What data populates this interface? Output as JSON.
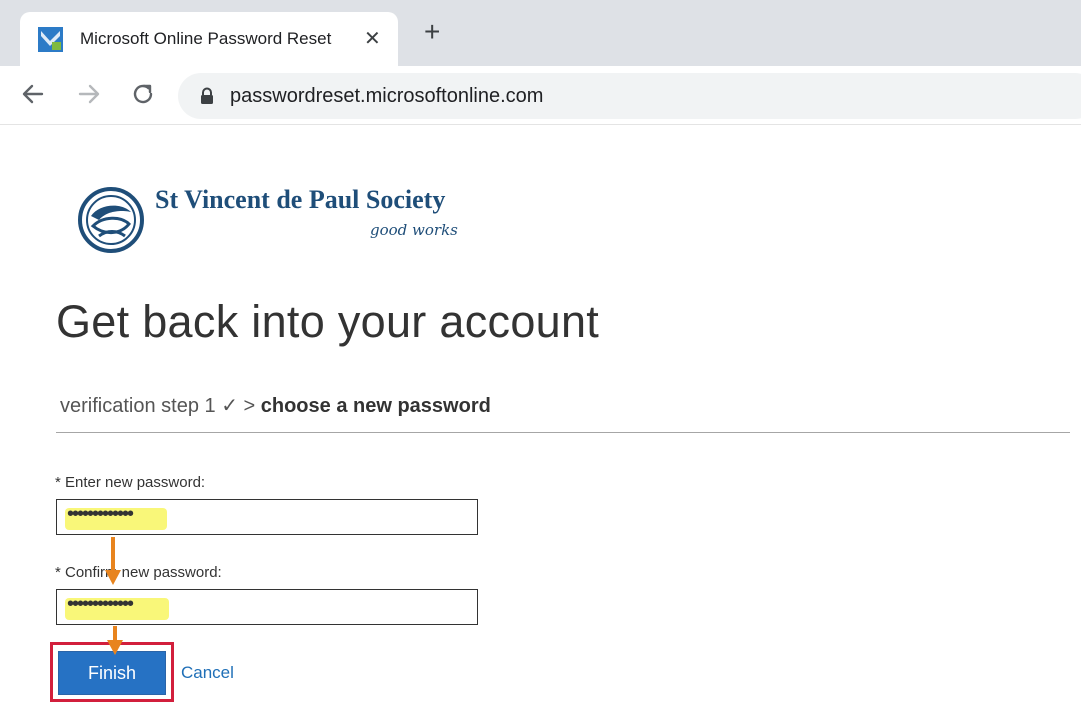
{
  "browser": {
    "tab": {
      "title": "Microsoft Online Password Reset",
      "close_glyph": "✕",
      "favicon": "microsoft-password-reset-favicon"
    },
    "new_tab_glyph": "+",
    "nav": {
      "back_icon": "arrow-left-icon",
      "forward_icon": "arrow-right-icon",
      "reload_icon": "reload-icon"
    },
    "address": {
      "url": "passwordreset.microsoftonline.com",
      "lock_icon": "lock-icon"
    }
  },
  "page": {
    "logo": {
      "emblem": "svdp-emblem-logo",
      "name": "St Vincent de Paul Society",
      "tagline": "good works"
    },
    "title": "Get back into your account",
    "breadcrumb": {
      "step1": "verification step 1 ✓ >",
      "current": "choose a new password"
    },
    "form": {
      "new_password": {
        "label": "* Enter new password:",
        "value": "•••••••••••••"
      },
      "confirm_password": {
        "label": "* Confirm new password:",
        "value": "•••••••••••••"
      },
      "finish_label": "Finish",
      "cancel_label": "Cancel"
    },
    "annotations": {
      "highlight_color": "#f8f66a",
      "arrow_color": "#e8841e",
      "box_color": "#d21f3c"
    }
  },
  "colors": {
    "title_text": "#333333",
    "brand_blue": "#1f4e79",
    "button_blue": "#2672c4",
    "link_blue": "#1f6fb7"
  }
}
